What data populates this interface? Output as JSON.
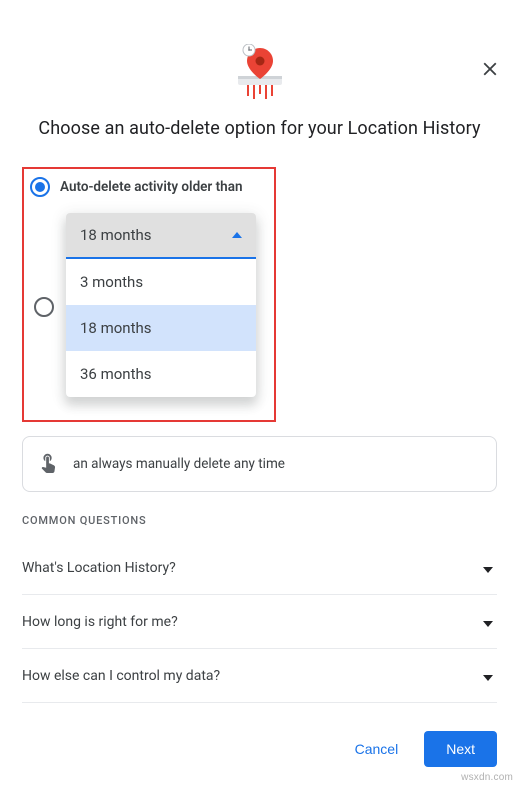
{
  "dialog": {
    "title": "Choose an auto-delete option for your Location History"
  },
  "options": {
    "primary_label": "Auto-delete activity older than",
    "dropdown": {
      "selected": "18 months",
      "items": [
        "3 months",
        "18 months",
        "36 months"
      ]
    }
  },
  "info": {
    "text": "an always manually delete any time"
  },
  "common_questions": {
    "heading": "Common Questions",
    "items": [
      "What's Location History?",
      "How long is right for me?",
      "How else can I control my data?"
    ]
  },
  "footer": {
    "cancel": "Cancel",
    "next": "Next"
  },
  "watermark": "wsxdn.com",
  "colors": {
    "primary": "#1a73e8",
    "highlight": "#e53935"
  }
}
